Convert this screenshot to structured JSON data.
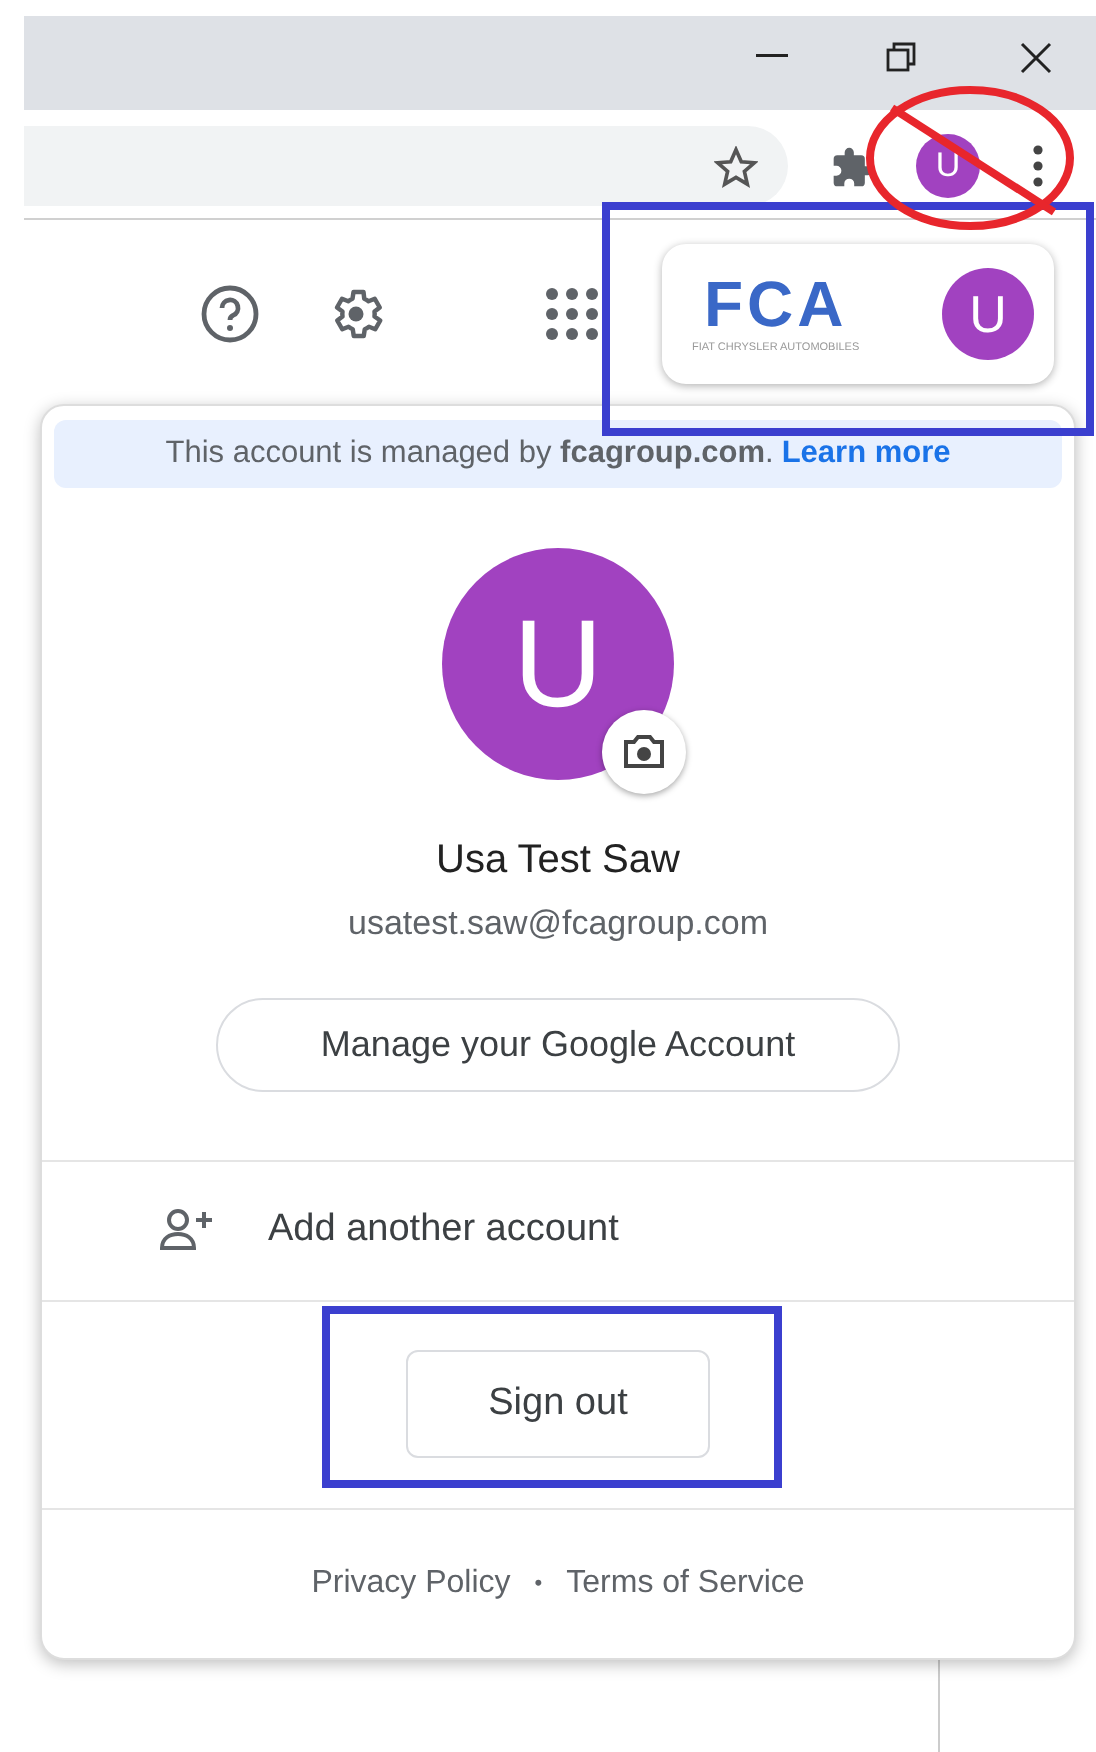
{
  "toolbar": {
    "profile_initial": "U"
  },
  "account_chip": {
    "logo_text": "FCA",
    "logo_subtitle": "FIAT CHRYSLER AUTOMOBILES",
    "initial": "U"
  },
  "account_menu": {
    "managed_notice": "This account is managed by **fcagroup.com**.",
    "learn_more": "Learn more",
    "avatar_initial": "U",
    "name": "Usa Test Saw",
    "email": "usatest.saw@fcagroup.com",
    "manage_button": "Manage your Google Account",
    "add_account": "Add another account",
    "sign_out": "Sign out",
    "footer_links": [
      "Privacy Policy",
      "Terms of Service"
    ],
    "footer_separator": "•"
  }
}
